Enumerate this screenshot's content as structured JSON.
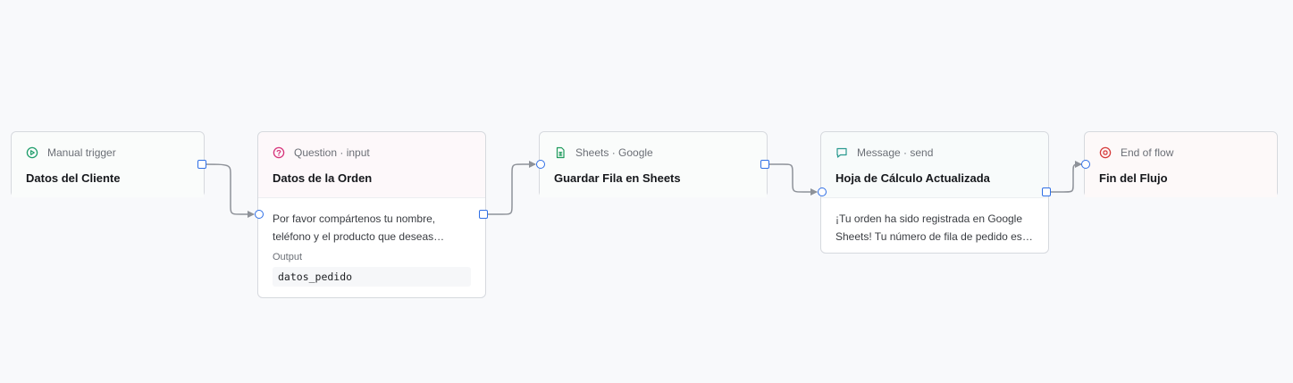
{
  "colors": {
    "trigger": "#1f9d6b",
    "question": "#d6327a",
    "sheets": "#1e9b5c",
    "message": "#2a9a8f",
    "end": "#d63a3a",
    "port": "#2f6fe6",
    "edge": "#8e9299"
  },
  "nodes": [
    {
      "id": "n1",
      "icon": "play-circle-icon",
      "kind": "Manual trigger",
      "title": "Datos del Cliente"
    },
    {
      "id": "n2",
      "icon": "question-circle-icon",
      "kind": "Question · input",
      "title": "Datos de la Orden",
      "description": "Por favor compártenos tu nombre, teléfono y el producto que deseas ordenar.",
      "output_label": "Output",
      "output_value": "datos_pedido"
    },
    {
      "id": "n3",
      "icon": "spreadsheet-icon",
      "kind": "Sheets · Google",
      "title": "Guardar Fila en Sheets"
    },
    {
      "id": "n4",
      "icon": "message-bubble-icon",
      "kind": "Message · send",
      "title": "Hoja de Cálculo Actualizada",
      "description": "¡Tu orden ha sido registrada en Google Sheets! Tu número de fila de pedido es el siguiente."
    },
    {
      "id": "n5",
      "icon": "stop-circle-icon",
      "kind": "End of flow",
      "title": "Fin del Flujo"
    }
  ]
}
